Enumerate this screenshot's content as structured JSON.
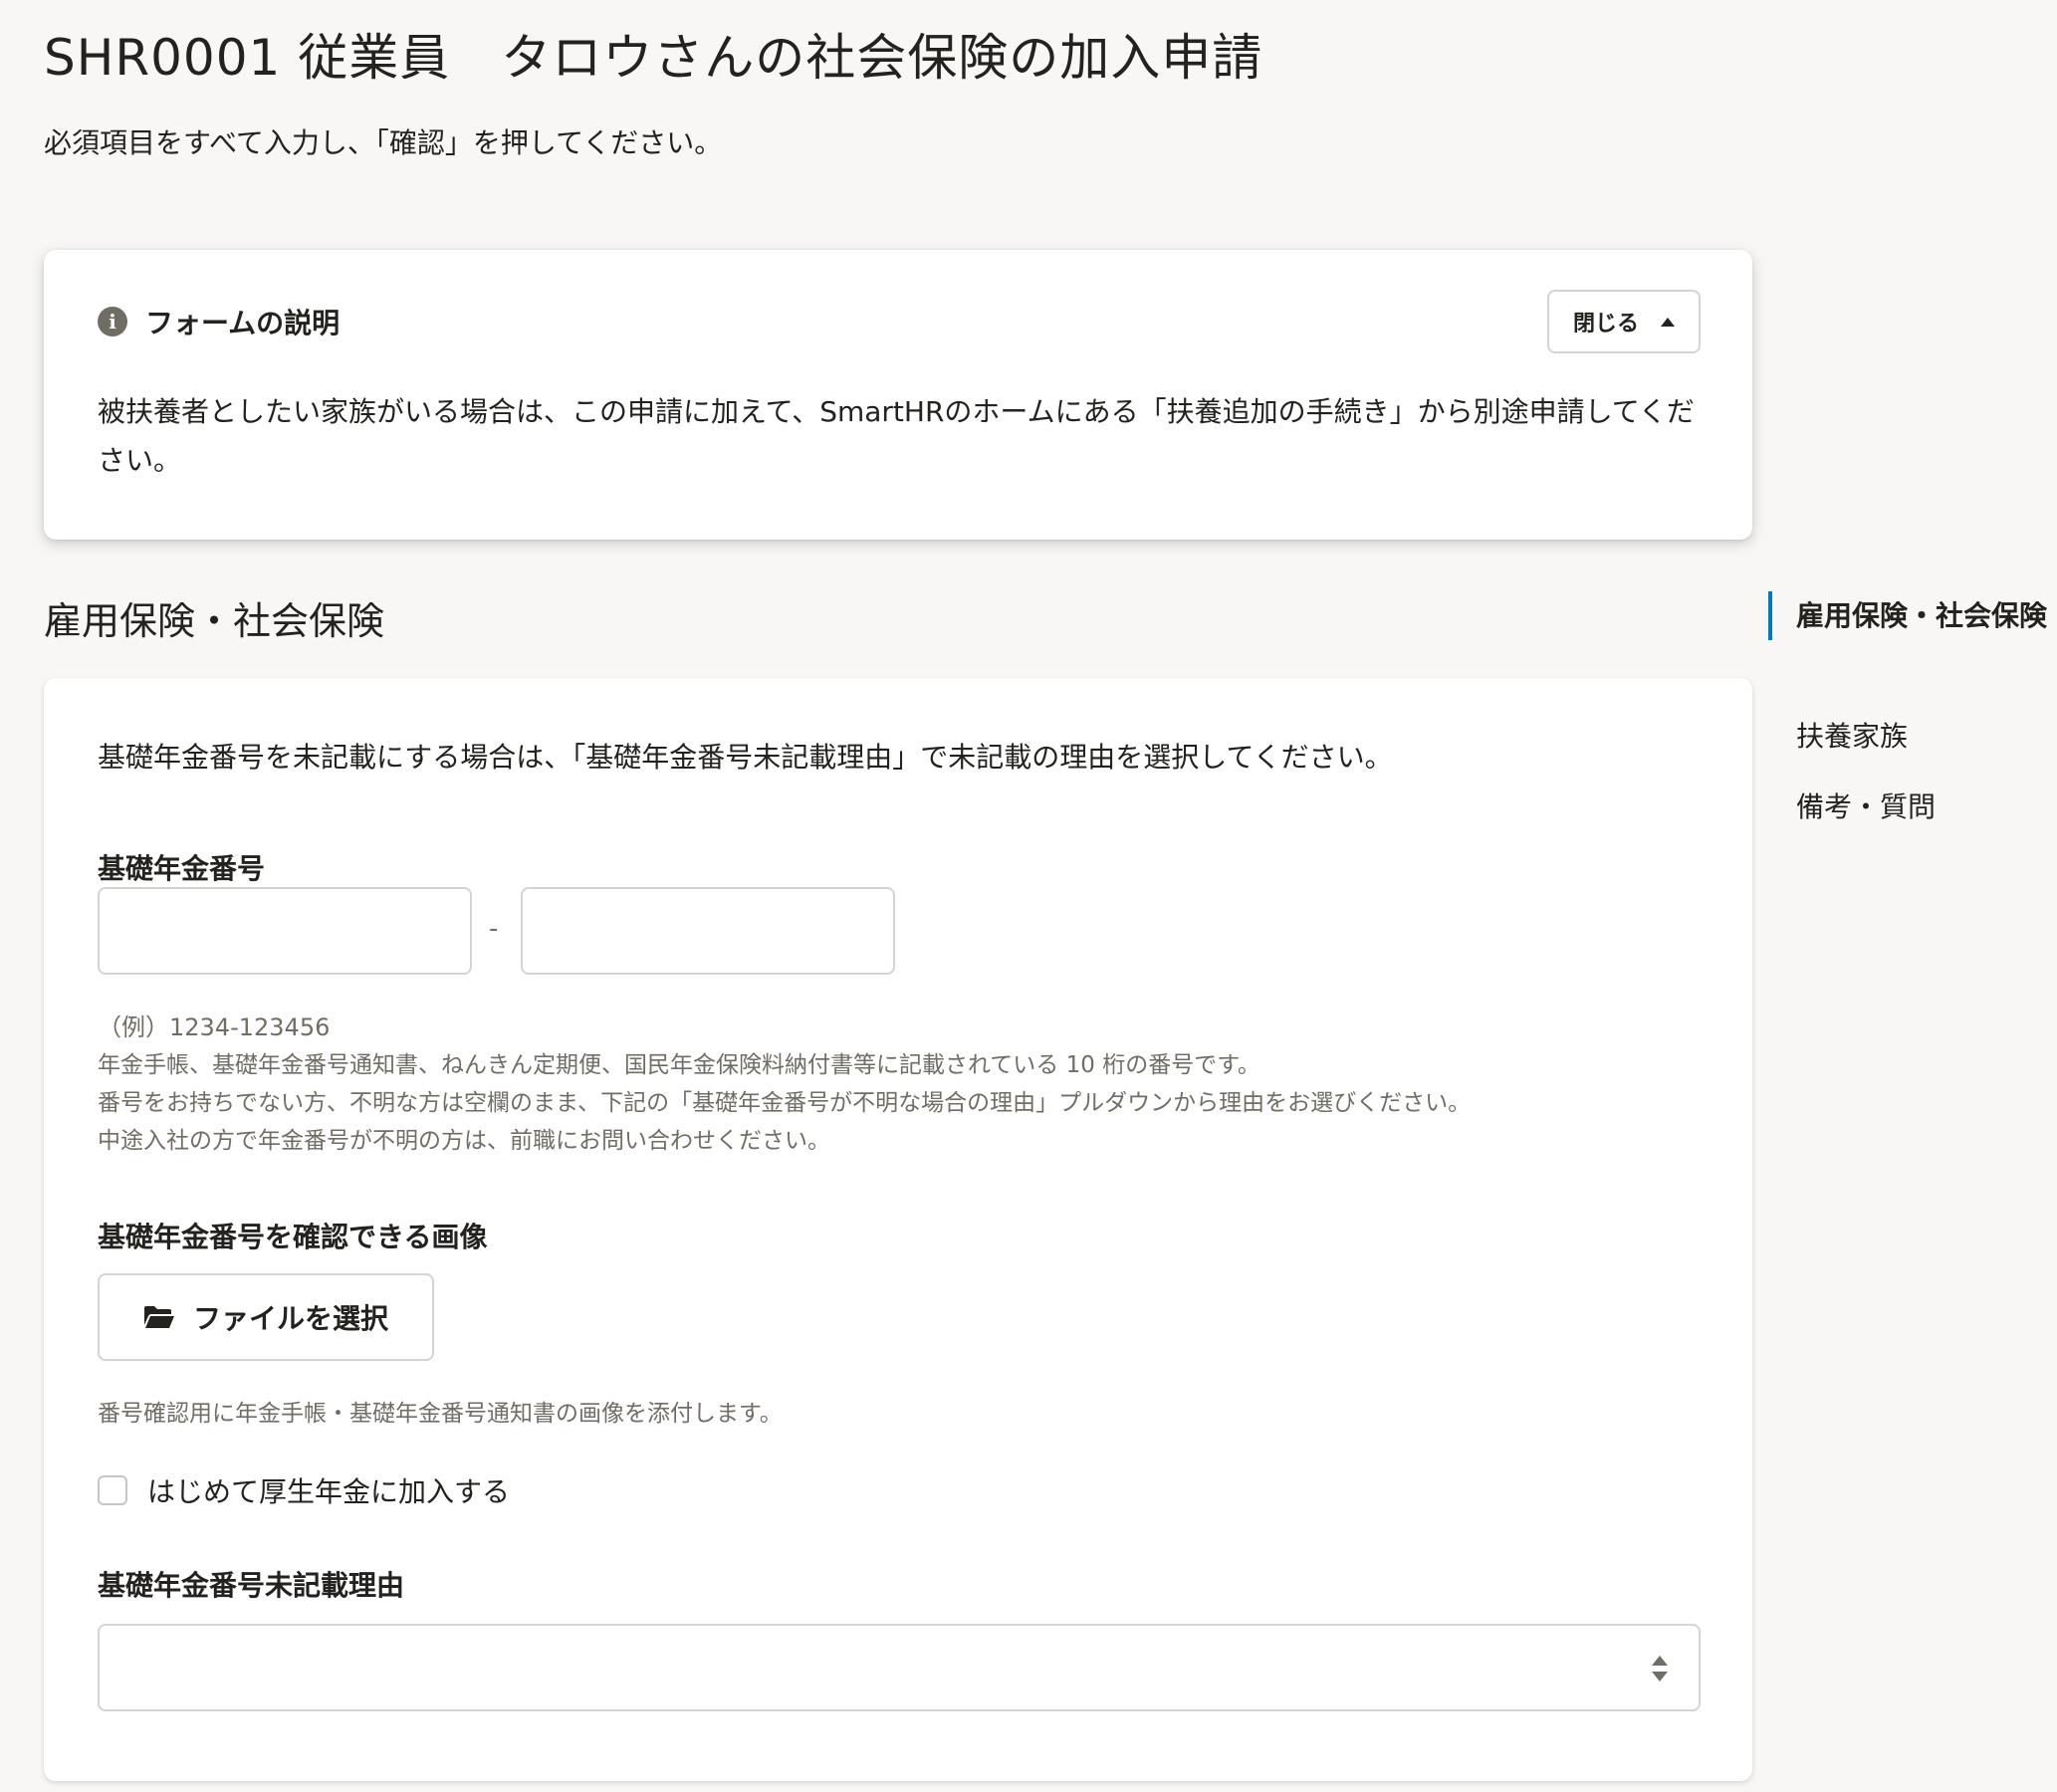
{
  "page": {
    "title": "SHR0001 従業員　タロウさんの社会保険の加入申請",
    "lead": "必須項目をすべて入力し、「確認」を押してください。"
  },
  "info_panel": {
    "icon": "info-circle-icon",
    "title": "フォームの説明",
    "close_label": "閉じる",
    "body": "被扶養者としたい家族がいる場合は、この申請に加えて、SmartHRのホームにある「扶養追加の手続き」から別途申請してください。"
  },
  "section": {
    "heading": "雇用保険・社会保険",
    "lead": "基礎年金番号を未記載にする場合は、「基礎年金番号未記載理由」で未記載の理由を選択してください。",
    "pension_number": {
      "label": "基礎年金番号",
      "part1_value": "",
      "part2_value": "",
      "separator": "-",
      "example": "（例）1234-123456",
      "hints": [
        "年金手帳、基礎年金番号通知書、ねんきん定期便、国民年金保険料納付書等に記載されている 10 桁の番号です。",
        "番号をお持ちでない方、不明な方は空欄のまま、下記の「基礎年金番号が不明な場合の理由」プルダウンから理由をお選びください。",
        "中途入社の方で年金番号が不明の方は、前職にお問い合わせください。"
      ]
    },
    "pension_image": {
      "label": "基礎年金番号を確認できる画像",
      "button_label": "ファイルを選択",
      "icon": "folder-open-icon",
      "hint": "番号確認用に年金手帳・基礎年金番号通知書の画像を添付します。"
    },
    "first_time_checkbox": {
      "label": "はじめて厚生年金に加入する",
      "checked": false
    },
    "missing_reason": {
      "label": "基礎年金番号未記載理由",
      "selected": ""
    }
  },
  "side_nav": {
    "items": [
      {
        "label": "雇用保険・社会保険",
        "active": true
      },
      {
        "label": "扶養家族",
        "active": false
      },
      {
        "label": "備考・質問",
        "active": false
      }
    ],
    "active_color": "#0077c7"
  }
}
